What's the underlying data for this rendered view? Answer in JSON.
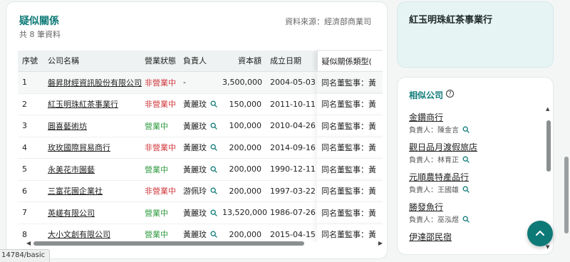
{
  "section": {
    "title": "疑似關係",
    "count_text": "共 8 筆資料",
    "source_text": "資料來源：經濟部商業司"
  },
  "table": {
    "headers": [
      "序號",
      "公司名稱",
      "營業狀態",
      "負責人",
      "資本額",
      "成立日期",
      "疑似關係類型("
    ],
    "rows": [
      {
        "idx": "1",
        "name": "磐昇財經資訊股份有限公司",
        "status": "非營業中",
        "status_type": "closed",
        "person": "-",
        "has_search": false,
        "capital": "3,500,000",
        "date": "2004-05-03",
        "type": "同名董監事：黃"
      },
      {
        "idx": "2",
        "name": "紅玉明珠紅茶事業行",
        "status": "非營業中",
        "status_type": "closed",
        "person": "黃麗玟",
        "has_search": true,
        "capital": "150,000",
        "date": "2011-10-11",
        "type": "同名董監事：黃"
      },
      {
        "idx": "3",
        "name": "圓喜藝術坊",
        "status": "營業中",
        "status_type": "open",
        "person": "黃麗玟",
        "has_search": true,
        "capital": "100,000",
        "date": "2010-04-26",
        "type": "同名董監事：黃"
      },
      {
        "idx": "4",
        "name": "玫玫國際貿易商行",
        "status": "非營業中",
        "status_type": "closed",
        "person": "黃麗玟",
        "has_search": true,
        "capital": "200,000",
        "date": "2014-09-16",
        "type": "同名董監事：黃"
      },
      {
        "idx": "5",
        "name": "永美花市園藝",
        "status": "營業中",
        "status_type": "open",
        "person": "黃麗玟",
        "has_search": true,
        "capital": "200,000",
        "date": "1990-12-11",
        "type": "同名董監事：黃"
      },
      {
        "idx": "6",
        "name": "三富花園企業社",
        "status": "非營業中",
        "status_type": "closed",
        "person": "游佩玲",
        "has_search": true,
        "capital": "200,000",
        "date": "1997-03-22",
        "type": "同名董監事：黃"
      },
      {
        "idx": "7",
        "name": "英嵯有限公司",
        "status": "營業中",
        "status_type": "open",
        "person": "黃麗玟",
        "has_search": true,
        "capital": "13,520,000",
        "date": "1986-07-26",
        "type": "同名董監事：黃"
      },
      {
        "idx": "8",
        "name": "大小文創有限公司",
        "status": "營業中",
        "status_type": "open",
        "person": "黃麗玟",
        "has_search": true,
        "capital": "200,000",
        "date": "2015-04-15",
        "type": "同名董監事：黃"
      }
    ]
  },
  "status_url": "14784/basic",
  "company_card": {
    "name": "紅玉明珠紅茶事業行"
  },
  "similar": {
    "title": "相似公司",
    "items": [
      {
        "name": "金鑽商行",
        "person": "負責人：陳金言"
      },
      {
        "name": "觀日品月渡假旅店",
        "person": "負責人：林育正"
      },
      {
        "name": "元順農特產品行",
        "person": "負責人：王國雄"
      },
      {
        "name": "勝發魚行",
        "person": "負責人：巫泓煜"
      },
      {
        "name": "伊達邵民宿",
        "person": ""
      }
    ]
  },
  "colors": {
    "accent": "#0e7a78",
    "status_open": "#2e9a3f",
    "status_closed": "#d0373b"
  },
  "icons": {
    "search": "search-icon",
    "help": "help-icon",
    "back_to_top": "chevron-up-icon"
  }
}
